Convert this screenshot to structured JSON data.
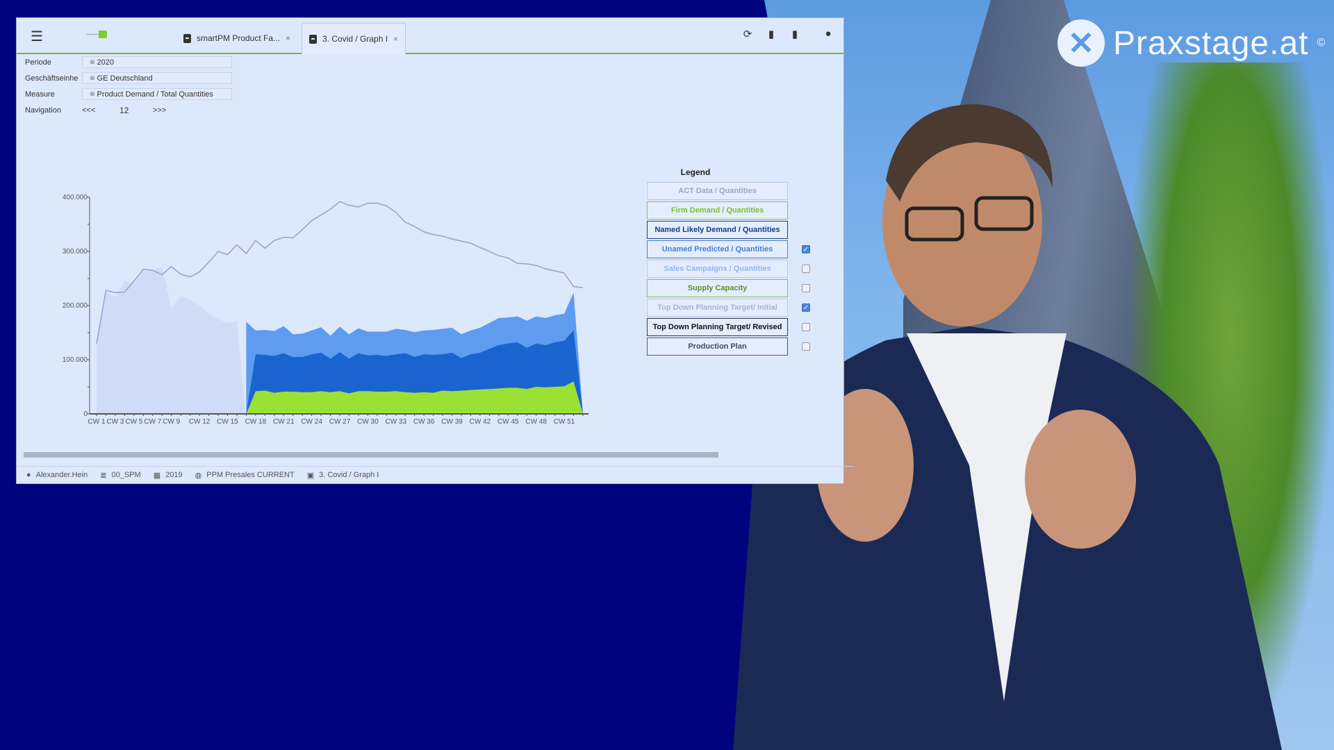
{
  "overlay": {
    "brand_name": "Praxstage.at",
    "brand_mark": "©"
  },
  "topbar": {
    "menu_icon": "hamburger-icon",
    "tabs": [
      {
        "label": "smartPM Product Fa...",
        "close": "×",
        "active": false
      },
      {
        "label": "3. Covid / Graph I",
        "close": "×",
        "active": true
      }
    ],
    "icons": [
      "refresh-icon",
      "pdf-export-icon",
      "excel-export-icon",
      "user-icon"
    ]
  },
  "filters": {
    "periode": {
      "label": "Periode",
      "value": "2020"
    },
    "geschaeftseinheit": {
      "label": "Geschäftseinhe",
      "value": "GE Deutschland"
    },
    "measure": {
      "label": "Measure",
      "value": "Product Demand / Total Quantities"
    },
    "navigation": {
      "label": "Navigation",
      "prev": "<<<",
      "page": "12",
      "next": ">>>"
    }
  },
  "legend": {
    "title": "Legend",
    "items": [
      {
        "label": "ACT Data / Quantities",
        "color": "#9aa6c4",
        "border": "#b9c8e4",
        "checked": null
      },
      {
        "label": "Firm Demand / Quantities",
        "color": "#7cc12a",
        "border": "#8cc152",
        "checked": null
      },
      {
        "label": "Named Likely Demand / Quantities",
        "color": "#1a3a8a",
        "border": "#2a3f7a",
        "checked": null
      },
      {
        "label": "Unamed Predicted / Quantities",
        "color": "#3f7fe0",
        "border": "#4a7ed0",
        "checked": true
      },
      {
        "label": "Sales Campaigns / Quantities",
        "color": "#8fb5f3",
        "border": "#b9c8e4",
        "checked": false
      },
      {
        "label": "Supply Capacity",
        "color": "#5c8f2a",
        "border": "#8cc152",
        "checked": false
      },
      {
        "label": "Top Down Planning Target/ Initial",
        "color": "#aab0d9",
        "border": "#b9c8e4",
        "checked": true
      },
      {
        "label": "Top Down Planning Target/ Revised",
        "color": "#111111",
        "border": "#333a55",
        "checked": false
      },
      {
        "label": "Production Plan",
        "color": "#444a60",
        "border": "#555b70",
        "checked": false
      }
    ]
  },
  "statusbar": {
    "user": "Alexander.Hein",
    "database": "00_SPM",
    "year": "2019",
    "scenario": "PPM Presales CURRENT",
    "report": "3. Covid / Graph I"
  },
  "chart_data": {
    "type": "area",
    "title": "",
    "xlabel": "",
    "ylabel": "",
    "ylim": [
      0,
      400000
    ],
    "yticks": [
      "0",
      "100.000",
      "200.000",
      "300.000",
      "400.000"
    ],
    "xtick_labels": [
      "CW 1",
      "CW 3",
      "CW 5",
      "CW 7",
      "CW 9",
      "CW 12",
      "CW 15",
      "CW 18",
      "CW 21",
      "CW 24",
      "CW 27",
      "CW 30",
      "CW 33",
      "CW 36",
      "CW 39",
      "CW 42",
      "CW 45",
      "CW 48",
      "CW 51"
    ],
    "x": [
      1,
      2,
      3,
      4,
      5,
      6,
      7,
      8,
      9,
      10,
      11,
      12,
      13,
      14,
      15,
      16,
      17,
      18,
      19,
      20,
      21,
      22,
      23,
      24,
      25,
      26,
      27,
      28,
      29,
      30,
      31,
      32,
      33,
      34,
      35,
      36,
      37,
      38,
      39,
      40,
      41,
      42,
      43,
      44,
      45,
      46,
      47,
      48,
      49,
      50,
      51,
      52,
      53
    ],
    "series": [
      {
        "name": "ACT Data / Quantities",
        "kind": "area",
        "color": "#cfdbf7",
        "values": [
          130000,
          225000,
          215000,
          245000,
          240000,
          265000,
          265000,
          270000,
          195000,
          218000,
          210000,
          200000,
          185000,
          175000,
          168000,
          170000,
          null,
          null,
          null,
          null,
          null,
          null,
          null,
          null,
          null,
          null,
          null,
          null,
          null,
          null,
          null,
          null,
          null,
          null,
          null,
          null,
          null,
          null,
          null,
          null,
          null,
          null,
          null,
          null,
          null,
          null,
          null,
          null,
          null,
          null,
          null,
          null,
          null
        ]
      },
      {
        "name": "Firm Demand / Quantities",
        "kind": "stack",
        "color": "#9be035",
        "values": [
          null,
          null,
          null,
          null,
          null,
          null,
          null,
          null,
          null,
          null,
          null,
          null,
          null,
          null,
          null,
          null,
          0,
          42000,
          43000,
          39000,
          41000,
          41000,
          40000,
          40000,
          42000,
          40000,
          42000,
          38000,
          42000,
          42000,
          41000,
          41000,
          42000,
          40000,
          39000,
          40000,
          39000,
          43000,
          42000,
          43000,
          44000,
          45000,
          46000,
          47000,
          48000,
          48000,
          46000,
          50000,
          49000,
          50000,
          51000,
          60000,
          0
        ]
      },
      {
        "name": "Named Likely Demand / Quantities",
        "kind": "stack",
        "color": "#1a64d0",
        "values": [
          null,
          null,
          null,
          null,
          null,
          null,
          null,
          null,
          null,
          null,
          null,
          null,
          null,
          null,
          null,
          null,
          0,
          68000,
          66000,
          68000,
          71000,
          64000,
          65000,
          70000,
          71000,
          62000,
          72000,
          64000,
          70000,
          66000,
          68000,
          66000,
          68000,
          72000,
          66000,
          70000,
          70000,
          67000,
          71000,
          60000,
          66000,
          68000,
          74000,
          80000,
          82000,
          84000,
          76000,
          80000,
          78000,
          82000,
          84000,
          94000,
          0
        ]
      },
      {
        "name": "Unamed Predicted / Quantities",
        "kind": "stack",
        "color": "#5e9cf0",
        "values": [
          null,
          null,
          null,
          null,
          null,
          null,
          null,
          null,
          null,
          null,
          null,
          null,
          null,
          null,
          null,
          null,
          170000,
          44000,
          46000,
          46000,
          50000,
          42000,
          43000,
          44000,
          47000,
          42000,
          47000,
          45000,
          46000,
          44000,
          43000,
          45000,
          47000,
          43000,
          46000,
          44000,
          46000,
          47000,
          46000,
          44000,
          44000,
          46000,
          48000,
          50000,
          48000,
          48000,
          50000,
          50000,
          50000,
          50000,
          50000,
          70000,
          0
        ]
      },
      {
        "name": "Top Down Planning Target/ Initial",
        "kind": "line",
        "color": "#a59ed2",
        "values": [
          130000,
          228000,
          224000,
          225000,
          245000,
          267000,
          265000,
          257000,
          272000,
          258000,
          253000,
          262000,
          280000,
          300000,
          294000,
          312000,
          296000,
          320000,
          306000,
          320000,
          326000,
          325000,
          340000,
          357000,
          367000,
          378000,
          392000,
          385000,
          382000,
          389000,
          389000,
          384000,
          372000,
          354000,
          346000,
          336000,
          331000,
          328000,
          323000,
          319000,
          315000,
          307000,
          300000,
          292000,
          288000,
          278000,
          277000,
          274000,
          268000,
          264000,
          260000,
          235000,
          233000
        ]
      }
    ],
    "legend_position": "right",
    "grid": false
  }
}
